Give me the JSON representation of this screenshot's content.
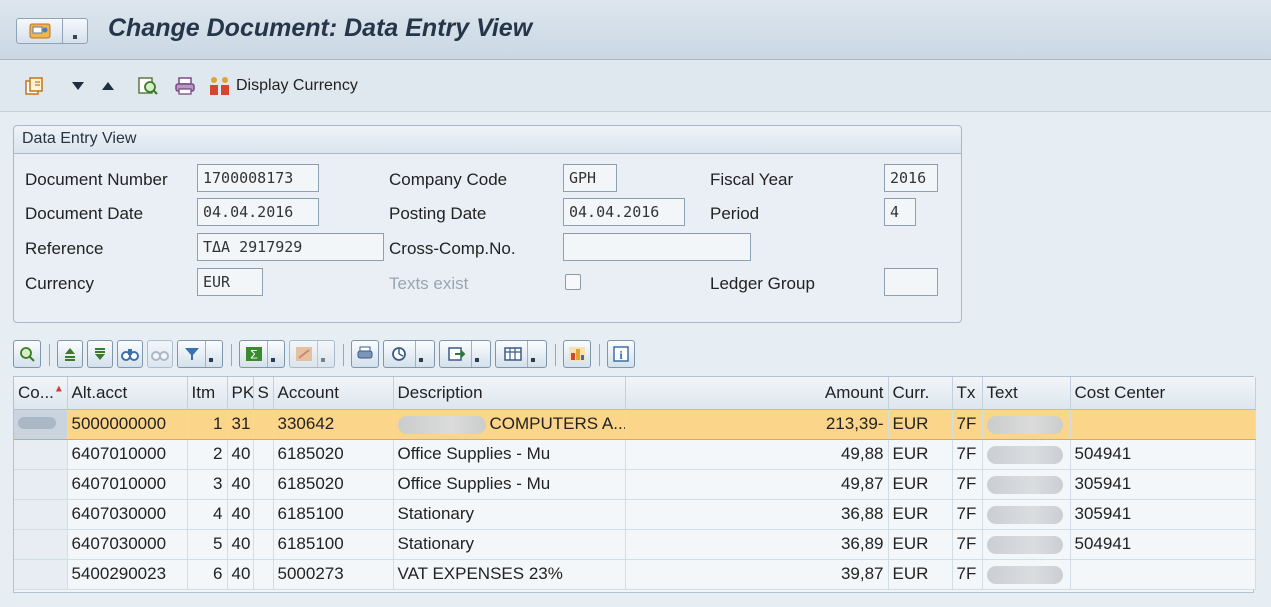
{
  "title": "Change Document: Data Entry View",
  "toolbar": {
    "display_currency": "Display Currency"
  },
  "group": {
    "header": "Data Entry View",
    "document_number_label": "Document Number",
    "document_number": "1700008173",
    "company_code_label": "Company Code",
    "company_code": "GPH",
    "fiscal_year_label": "Fiscal Year",
    "fiscal_year": "2016",
    "document_date_label": "Document Date",
    "document_date": "04.04.2016",
    "posting_date_label": "Posting Date",
    "posting_date": "04.04.2016",
    "period_label": "Period",
    "period": "4",
    "reference_label": "Reference",
    "reference": "ΤΔΑ 2917929",
    "cross_comp_label": "Cross-Comp.No.",
    "cross_comp": "",
    "currency_label": "Currency",
    "currency": "EUR",
    "texts_exist_label": "Texts exist",
    "ledger_group_label": "Ledger Group",
    "ledger_group": ""
  },
  "table": {
    "columns": [
      "Co...",
      "Alt.acct",
      "Itm",
      "PK",
      "S",
      "Account",
      "Description",
      "Amount",
      "Curr.",
      "Tx",
      "Text",
      "Cost Center"
    ],
    "rows": [
      {
        "alt": "5000000000",
        "itm": "1",
        "pk": "31",
        "s": "",
        "account": "330642",
        "desc": "COMPUTERS A...",
        "amount": "213,39-",
        "curr": "EUR",
        "tx": "7F",
        "cc": ""
      },
      {
        "alt": "6407010000",
        "itm": "2",
        "pk": "40",
        "s": "",
        "account": "6185020",
        "desc": "Office Supplies - Mu",
        "amount": "49,88",
        "curr": "EUR",
        "tx": "7F",
        "cc": "504941"
      },
      {
        "alt": "6407010000",
        "itm": "3",
        "pk": "40",
        "s": "",
        "account": "6185020",
        "desc": "Office Supplies - Mu",
        "amount": "49,87",
        "curr": "EUR",
        "tx": "7F",
        "cc": "305941"
      },
      {
        "alt": "6407030000",
        "itm": "4",
        "pk": "40",
        "s": "",
        "account": "6185100",
        "desc": "Stationary",
        "amount": "36,88",
        "curr": "EUR",
        "tx": "7F",
        "cc": "305941"
      },
      {
        "alt": "6407030000",
        "itm": "5",
        "pk": "40",
        "s": "",
        "account": "6185100",
        "desc": "Stationary",
        "amount": "36,89",
        "curr": "EUR",
        "tx": "7F",
        "cc": "504941"
      },
      {
        "alt": "5400290023",
        "itm": "6",
        "pk": "40",
        "s": "",
        "account": "5000273",
        "desc": "VAT EXPENSES 23%",
        "amount": "39,87",
        "curr": "EUR",
        "tx": "7F",
        "cc": ""
      }
    ]
  },
  "colors": {
    "selected_row": "#fbd58a",
    "background": "#e6edf3",
    "title": "#26364a"
  }
}
